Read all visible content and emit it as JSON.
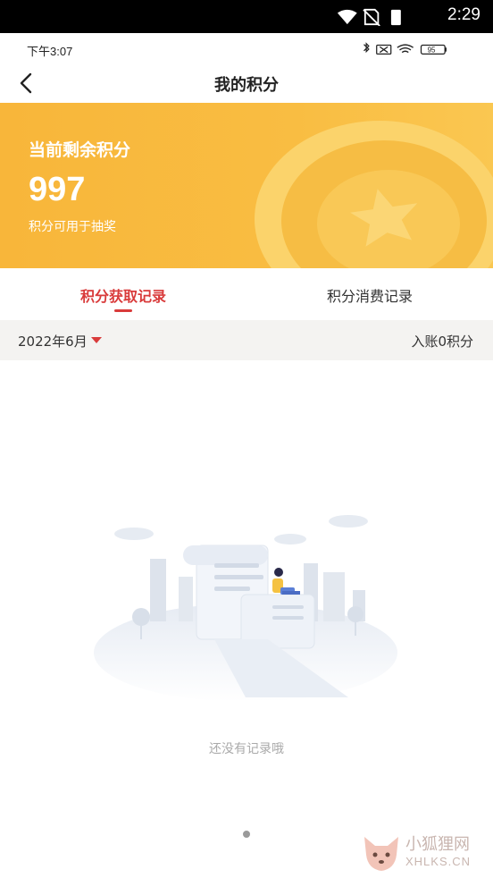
{
  "system_bar": {
    "time": "2:29"
  },
  "inner_status": {
    "time": "下午3:07",
    "battery": "95"
  },
  "header": {
    "title": "我的积分"
  },
  "banner": {
    "label": "当前剩余积分",
    "points": "997",
    "subtitle": "积分可用于抽奖"
  },
  "tabs": [
    {
      "label": "积分获取记录",
      "active": true
    },
    {
      "label": "积分消费记录",
      "active": false
    }
  ],
  "filter": {
    "month": "2022年6月",
    "summary": "入账0积分"
  },
  "empty": {
    "message": "还没有记录哦"
  },
  "watermark": {
    "cn": "小狐狸网",
    "en": "XHLKS.CN"
  },
  "colors": {
    "accent": "#d93b3b",
    "banner": "#f9bd42"
  }
}
